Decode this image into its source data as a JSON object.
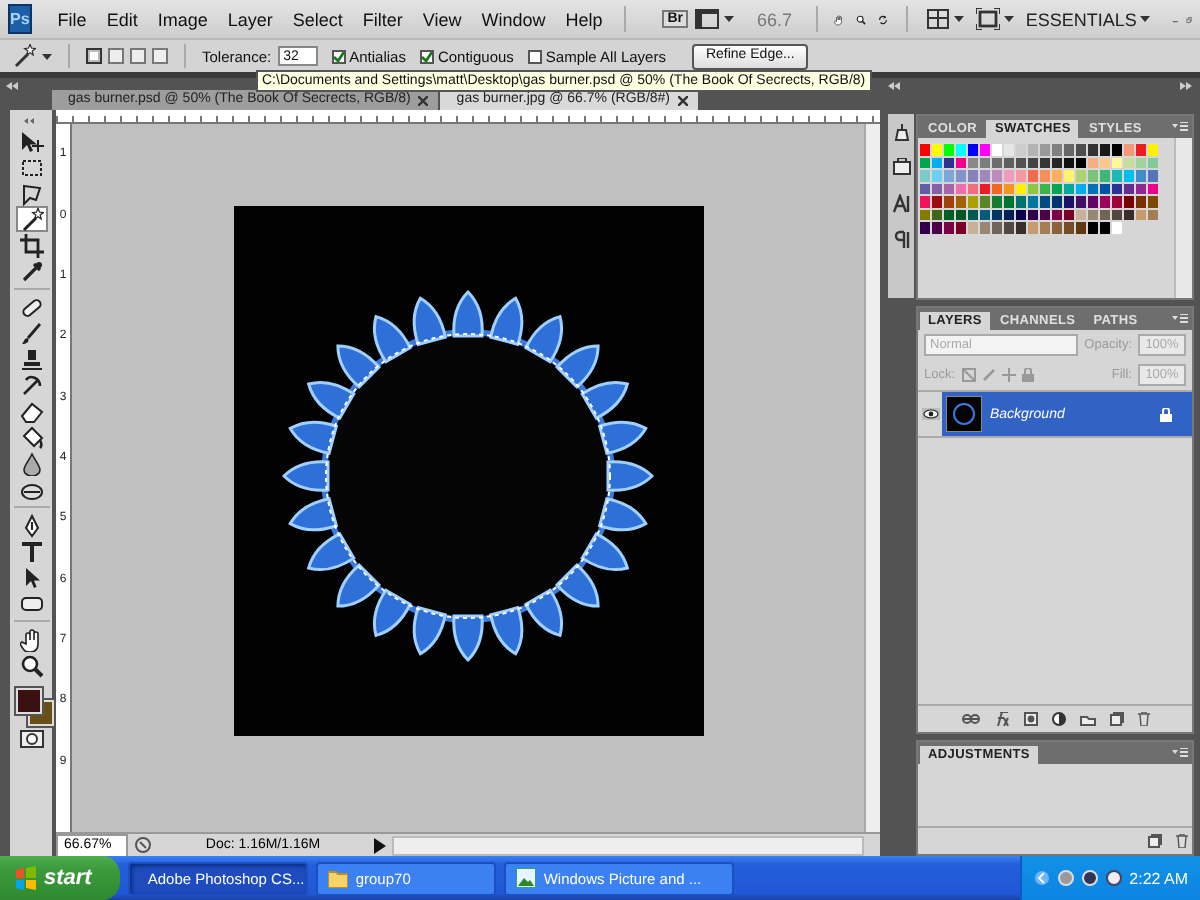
{
  "menubar": {
    "logo": "Ps",
    "items": [
      "File",
      "Edit",
      "Image",
      "Layer",
      "Select",
      "Filter",
      "View",
      "Window",
      "Help"
    ],
    "bridge": "Br",
    "zoom": "66.7",
    "workspace": "ESSENTIALS"
  },
  "options_bar": {
    "modes": [
      {
        "selected": true
      },
      {
        "selected": false
      },
      {
        "selected": false
      },
      {
        "selected": false
      }
    ],
    "tolerance_label": "Tolerance:",
    "tolerance": "32",
    "checkboxes": [
      {
        "label": "Antialias",
        "checked": true
      },
      {
        "label": "Contiguous",
        "checked": true
      },
      {
        "label": "Sample All Layers",
        "checked": false
      }
    ],
    "refine_button": "Refine Edge..."
  },
  "tooltip": "C:\\Documents and Settings\\matt\\Desktop\\gas burner.psd @ 50% (The Book  Of Secrects, RGB/8)",
  "document_tabs": [
    {
      "title": "gas burner.psd @ 50% (The Book  Of Secrects, RGB/8)",
      "selected": false
    },
    {
      "title": "gas burner.jpg @ 66.7% (RGB/8#)",
      "selected": true
    }
  ],
  "tools": [
    {
      "kind": "move",
      "selected": false
    },
    {
      "kind": "marquee",
      "selected": false
    },
    {
      "kind": "lasso",
      "selected": false
    },
    {
      "kind": "wand",
      "selected": true
    },
    {
      "kind": "crop",
      "selected": false
    },
    {
      "kind": "eyedropper",
      "selected": false
    },
    {
      "kind": "healing",
      "selected": false
    },
    {
      "kind": "brush",
      "selected": false
    },
    {
      "kind": "stamp",
      "selected": false
    },
    {
      "kind": "history",
      "selected": false
    },
    {
      "kind": "eraser",
      "selected": false
    },
    {
      "kind": "bucket",
      "selected": false
    },
    {
      "kind": "blur",
      "selected": false
    },
    {
      "kind": "dodge",
      "selected": false
    },
    {
      "kind": "pen",
      "selected": false
    },
    {
      "kind": "type",
      "selected": false
    },
    {
      "kind": "select",
      "selected": false
    },
    {
      "kind": "shape",
      "selected": false
    },
    {
      "kind": "hand",
      "selected": false
    },
    {
      "kind": "zoom",
      "selected": false
    }
  ],
  "colors": [
    {
      "kind": "foreground",
      "color": "#3a1010"
    },
    {
      "kind": "background",
      "color": "#6b4e16"
    }
  ],
  "ruler": {
    "vertical_labels": [
      "1",
      "0",
      "1",
      "2",
      "3",
      "4",
      "5",
      "6",
      "7",
      "8",
      "9"
    ]
  },
  "status_bar": {
    "zoom": "66.67%",
    "doc_info": "Doc: 1.16M/1.16M"
  },
  "swatches_panel": {
    "tabs": [
      {
        "label": "COLOR",
        "selected": false
      },
      {
        "label": "SWATCHES",
        "selected": true
      },
      {
        "label": "STYLES",
        "selected": false
      }
    ],
    "rows": [
      [
        {
          "color": "#ff0000"
        },
        {
          "color": "#ffff00"
        },
        {
          "color": "#00ff00"
        },
        {
          "color": "#00ffff"
        },
        {
          "color": "#0000ff"
        },
        {
          "color": "#ff00ff"
        },
        {
          "color": "#ffffff"
        },
        {
          "color": "#e6e6e6"
        },
        {
          "color": "#cccccc"
        },
        {
          "color": "#b3b3b3"
        },
        {
          "color": "#999999"
        },
        {
          "color": "#808080"
        },
        {
          "color": "#666666"
        },
        {
          "color": "#4d4d4d"
        },
        {
          "color": "#333333"
        },
        {
          "color": "#1a1a1a"
        },
        {
          "color": "#000000"
        },
        {
          "color": "#f7977a"
        },
        {
          "color": "#ed1c24"
        },
        {
          "color": "#fff200"
        }
      ],
      [
        {
          "color": "#00a651"
        },
        {
          "color": "#00aeef"
        },
        {
          "color": "#2e3192"
        },
        {
          "color": "#ec008c"
        },
        {
          "color": "#898989"
        },
        {
          "color": "#7d7d7d"
        },
        {
          "color": "#6d6d6d"
        },
        {
          "color": "#5f5f5f"
        },
        {
          "color": "#525252"
        },
        {
          "color": "#444444"
        },
        {
          "color": "#363636"
        },
        {
          "color": "#262626"
        },
        {
          "color": "#111111"
        },
        {
          "color": "#000000"
        },
        {
          "color": "#f9ad81"
        },
        {
          "color": "#fdc68a"
        },
        {
          "color": "#fff79a"
        },
        {
          "color": "#c4df9b"
        },
        {
          "color": "#a3d39c"
        },
        {
          "color": "#82ca9c"
        }
      ],
      [
        {
          "color": "#7accc8"
        },
        {
          "color": "#6dcff6"
        },
        {
          "color": "#7da7d9"
        },
        {
          "color": "#8393ca"
        },
        {
          "color": "#8781bd"
        },
        {
          "color": "#a187be"
        },
        {
          "color": "#bd8cbf"
        },
        {
          "color": "#f49ac1"
        },
        {
          "color": "#f6989d"
        },
        {
          "color": "#f26c4f"
        },
        {
          "color": "#f68e55"
        },
        {
          "color": "#fbaf5d"
        },
        {
          "color": "#fff467"
        },
        {
          "color": "#acd372"
        },
        {
          "color": "#7cc576"
        },
        {
          "color": "#3bb878"
        },
        {
          "color": "#1abbb4"
        },
        {
          "color": "#00bff3"
        },
        {
          "color": "#438ccb"
        },
        {
          "color": "#5574b9"
        }
      ],
      [
        {
          "color": "#605ca8"
        },
        {
          "color": "#8560a8"
        },
        {
          "color": "#a864a8"
        },
        {
          "color": "#f06eaa"
        },
        {
          "color": "#f26d7d"
        },
        {
          "color": "#ed1c24"
        },
        {
          "color": "#f26522"
        },
        {
          "color": "#f7941d"
        },
        {
          "color": "#fff200"
        },
        {
          "color": "#8dc73f"
        },
        {
          "color": "#39b54a"
        },
        {
          "color": "#00a651"
        },
        {
          "color": "#00a99d"
        },
        {
          "color": "#00aeef"
        },
        {
          "color": "#0072bc"
        },
        {
          "color": "#0054a6"
        },
        {
          "color": "#2e3192"
        },
        {
          "color": "#662d91"
        },
        {
          "color": "#92278f"
        },
        {
          "color": "#ec008c"
        }
      ],
      [
        {
          "color": "#ed145b"
        },
        {
          "color": "#9e0b0f"
        },
        {
          "color": "#a0410d"
        },
        {
          "color": "#a36209"
        },
        {
          "color": "#aba000"
        },
        {
          "color": "#598527"
        },
        {
          "color": "#197b30"
        },
        {
          "color": "#007236"
        },
        {
          "color": "#00746b"
        },
        {
          "color": "#0076a3"
        },
        {
          "color": "#004b80"
        },
        {
          "color": "#003471"
        },
        {
          "color": "#1b1464"
        },
        {
          "color": "#440e62"
        },
        {
          "color": "#630460"
        },
        {
          "color": "#9e005d"
        },
        {
          "color": "#9e0039"
        },
        {
          "color": "#790000"
        },
        {
          "color": "#7b2e00"
        },
        {
          "color": "#7d4900"
        }
      ],
      [
        {
          "color": "#827b00"
        },
        {
          "color": "#406618"
        },
        {
          "color": "#005e20"
        },
        {
          "color": "#005826"
        },
        {
          "color": "#005952"
        },
        {
          "color": "#005b7f"
        },
        {
          "color": "#003663"
        },
        {
          "color": "#002157"
        },
        {
          "color": "#0d004c"
        },
        {
          "color": "#32004b"
        },
        {
          "color": "#4b0049"
        },
        {
          "color": "#7b0046"
        },
        {
          "color": "#7a0026"
        },
        {
          "color": "#c7b299"
        },
        {
          "color": "#998675"
        },
        {
          "color": "#736357"
        },
        {
          "color": "#534741"
        },
        {
          "color": "#37302a"
        },
        {
          "color": "#c69c6d"
        },
        {
          "color": "#a67c52"
        }
      ],
      [
        {
          "color": "#32004b"
        },
        {
          "color": "#4b0049"
        },
        {
          "color": "#7b0046"
        },
        {
          "color": "#7a0026"
        },
        {
          "color": "#c7b299"
        },
        {
          "color": "#998675"
        },
        {
          "color": "#736357"
        },
        {
          "color": "#534741"
        },
        {
          "color": "#37302a"
        },
        {
          "color": "#c69c6d"
        },
        {
          "color": "#a67c52"
        },
        {
          "color": "#8c6239"
        },
        {
          "color": "#754c24"
        },
        {
          "color": "#603913"
        },
        {
          "color": "#000000"
        },
        {
          "color": "#000000"
        },
        {
          "color": "#ffffff"
        }
      ]
    ]
  },
  "layers_panel": {
    "tabs": [
      {
        "label": "LAYERS",
        "selected": true
      },
      {
        "label": "CHANNELS",
        "selected": false
      },
      {
        "label": "PATHS",
        "selected": false
      }
    ],
    "blend_mode": "Normal",
    "opacity_label": "Opacity:",
    "opacity": "100%",
    "lock_label": "Lock:",
    "fill_label": "Fill:",
    "fill": "100%",
    "layers": [
      {
        "name": "Background",
        "selected": true,
        "visible": true,
        "locked": true
      }
    ]
  },
  "adjustments_panel": {
    "title": "ADJUSTMENTS"
  },
  "taskbar": {
    "start": "start",
    "buttons": [
      {
        "kind": "photoshop",
        "label": "Adobe Photoshop CS...",
        "selected": true
      },
      {
        "kind": "folder",
        "label": "group70",
        "selected": false
      },
      {
        "kind": "picture",
        "label": "Windows Picture and ...",
        "selected": false
      }
    ],
    "clock": "2:22 AM"
  }
}
